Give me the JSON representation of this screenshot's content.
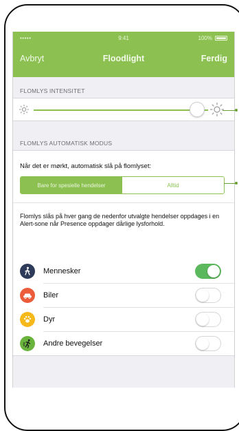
{
  "status_bar": {
    "signal": "••••• ",
    "time": "9:41",
    "battery": "100%"
  },
  "navbar": {
    "cancel_label": "Avbryt",
    "title": "Floodlight",
    "done_label": "Ferdig"
  },
  "intensity": {
    "header": "FLOMLYS INTENSITET",
    "value_percent": 92
  },
  "auto_mode": {
    "header": "FLOMLYS AUTOMATISK MODUS",
    "prompt": "Når det er mørkt, automatisk slå på flomlyset:",
    "options": [
      "Bare for spesielle hendelser",
      "Alltid"
    ],
    "selected_option": "Bare for spesielle hendelser"
  },
  "description": "Flomlys slås på hver gang de nedenfor utvalgte hendelser oppdages i en Alert-sone når Presence oppdager dårlige lysforhold.",
  "events": [
    {
      "label": "Mennesker",
      "icon": "person-icon",
      "color": "#2e3a59",
      "enabled": true
    },
    {
      "label": "Biler",
      "icon": "car-icon",
      "color": "#ec5b3a",
      "enabled": false
    },
    {
      "label": "Dyr",
      "icon": "paw-icon",
      "color": "#f5b91b",
      "enabled": false
    },
    {
      "label": "Andre bevegelser",
      "icon": "motion-icon",
      "color": "#6ab43e",
      "enabled": false
    }
  ],
  "colors": {
    "accent": "#8cc152",
    "toggle_on": "#5cb85c",
    "background": "#efeff4"
  }
}
